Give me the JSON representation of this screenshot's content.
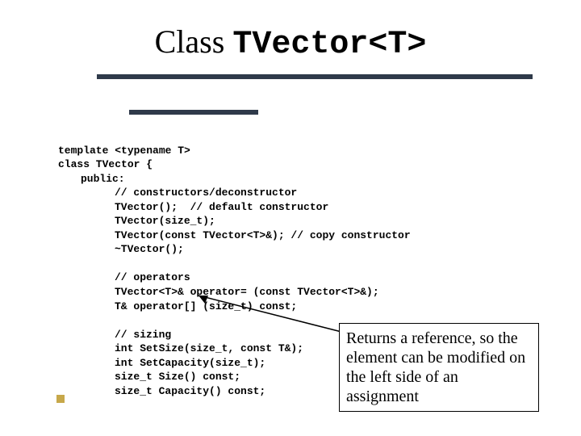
{
  "title": {
    "prefix": "Class ",
    "mono": "TVector<T>"
  },
  "code": {
    "l1": "template <typename T>",
    "l2": "class TVector {",
    "l3": "public:",
    "l4": "// constructors/deconstructor",
    "l5": "TVector();  // default constructor",
    "l6": "TVector(size_t);",
    "l7": "TVector(const TVector<T>&); // copy constructor",
    "l8": "~TVector();",
    "blank1": "",
    "l9": "// operators",
    "l10": "TVector<T>& operator= (const TVector<T>&);",
    "l11": "T& operator[] (size_t) const;",
    "blank2": "",
    "l12": "// sizing",
    "l13": "int SetSize(size_t, const T&);",
    "l14": "int SetCapacity(size_t);",
    "l15": "size_t Size() const;",
    "l16": "size_t Capacity() const;"
  },
  "callout": "Returns a reference, so the element can be modified on the left side of an assignment"
}
